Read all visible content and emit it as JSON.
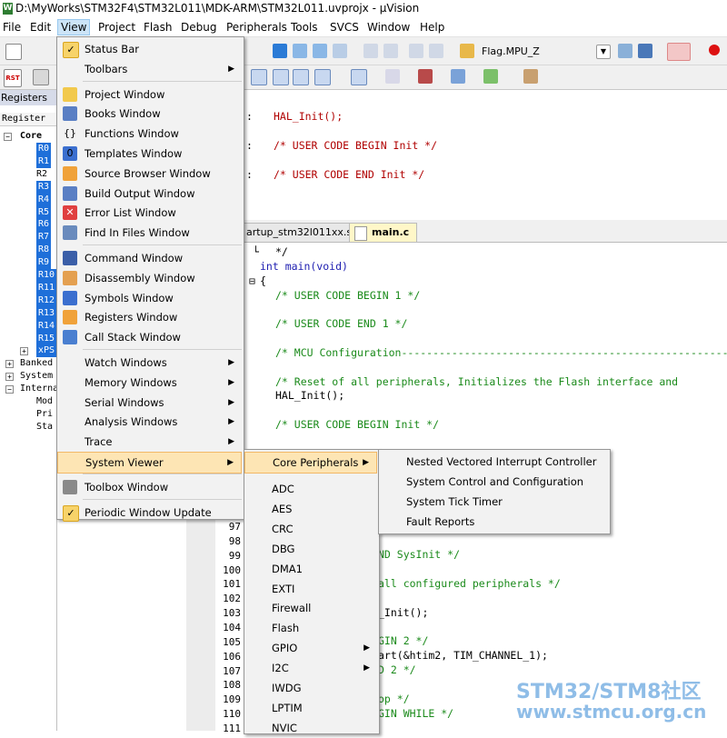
{
  "window": {
    "title": "D:\\MyWorks\\STM32F4\\STM32L011\\MDK-ARM\\STM32L011.uvprojx - µVision"
  },
  "menubar": [
    "File",
    "Edit",
    "View",
    "Project",
    "Flash",
    "Debug",
    "Peripherals",
    "Tools",
    "SVCS",
    "Window",
    "Help"
  ],
  "toolbar": {
    "target_name": "Flag.MPU_Z"
  },
  "registers": {
    "pane_title": "Registers",
    "column_header": "Register",
    "tree": {
      "core": "Core",
      "core_regs": [
        "R0",
        "R1",
        "R2",
        "R3",
        "R4",
        "R5",
        "R6",
        "R7",
        "R8",
        "R9",
        "R10",
        "R11",
        "R12",
        "R13",
        "R14",
        "R15",
        "xPS"
      ],
      "groups": [
        "Banked",
        "System",
        "Interna"
      ],
      "internal_children": [
        "Mod",
        "Pri",
        "Sta"
      ]
    }
  },
  "editor_top": {
    "lines": [
      "HAL_Init();",
      "/* USER CODE BEGIN Init */",
      "/* USER CODE END Init */"
    ]
  },
  "tabs": [
    "artup_stm32l011xx.s",
    "main.c"
  ],
  "editor_main": {
    "line_numbers": [
      "97",
      "98",
      "99",
      "100",
      "101",
      "102",
      "103",
      "104",
      "105",
      "106",
      "107",
      "108",
      "109",
      "110",
      "111"
    ],
    "lines": [
      "*/",
      "int main(void)",
      "{",
      "/* USER CODE BEGIN 1 */",
      "/* USER CODE END 1 */",
      "/* MCU Configuration--------------------------------------------------------",
      "/* Reset of all peripherals, Initializes the Flash interface and",
      "HAL_Init();",
      "/* USER CODE BEGIN Init */"
    ],
    "partial_lines": [
      "ND SysInit */",
      "all configured peripherals */",
      "_Init();",
      "GIN 2 */",
      "art(&htim2, TIM_CHANNEL_1);",
      "D 2 */",
      "op */",
      "GIN WHILE */"
    ]
  },
  "view_menu": {
    "items": [
      {
        "label": "Status Bar",
        "icon": "check-icon"
      },
      {
        "label": "Toolbars",
        "submenu": true
      },
      {
        "label": "Project Window",
        "icon": "project-window-icon"
      },
      {
        "label": "Books Window",
        "icon": "books-icon"
      },
      {
        "label": "Functions Window",
        "icon": "braces-icon"
      },
      {
        "label": "Templates Window",
        "icon": "templates-icon"
      },
      {
        "label": "Source Browser Window",
        "icon": "source-browser-icon"
      },
      {
        "label": "Build Output Window",
        "icon": "build-output-icon"
      },
      {
        "label": "Error List Window",
        "icon": "error-list-icon"
      },
      {
        "label": "Find In Files Window",
        "icon": "find-in-files-icon"
      },
      {
        "label": "Command Window",
        "icon": "command-window-icon"
      },
      {
        "label": "Disassembly Window",
        "icon": "disassembly-icon"
      },
      {
        "label": "Symbols Window",
        "icon": "symbols-icon"
      },
      {
        "label": "Registers Window",
        "icon": "registers-icon"
      },
      {
        "label": "Call Stack Window",
        "icon": "call-stack-icon"
      },
      {
        "label": "Watch Windows",
        "submenu": true
      },
      {
        "label": "Memory Windows",
        "submenu": true
      },
      {
        "label": "Serial Windows",
        "submenu": true
      },
      {
        "label": "Analysis Windows",
        "submenu": true
      },
      {
        "label": "Trace",
        "submenu": true
      },
      {
        "label": "System Viewer",
        "submenu": true,
        "highlighted": true
      },
      {
        "label": "Toolbox Window",
        "icon": "toolbox-icon"
      },
      {
        "label": "Periodic Window Update",
        "icon": "check-icon"
      }
    ]
  },
  "system_viewer_menu": {
    "items": [
      "Core Peripherals",
      "ADC",
      "AES",
      "CRC",
      "DBG",
      "DMA1",
      "EXTI",
      "Firewall",
      "Flash",
      "GPIO",
      "I2C",
      "IWDG",
      "LPTIM",
      "NVIC"
    ]
  },
  "core_peripherals_menu": {
    "items": [
      "Nested Vectored Interrupt Controller",
      "System Control and Configuration",
      "System Tick Timer",
      "Fault Reports"
    ]
  },
  "watermark": {
    "line1": "STM32/STM8社区",
    "line2": "www.stmcu.org.cn"
  }
}
